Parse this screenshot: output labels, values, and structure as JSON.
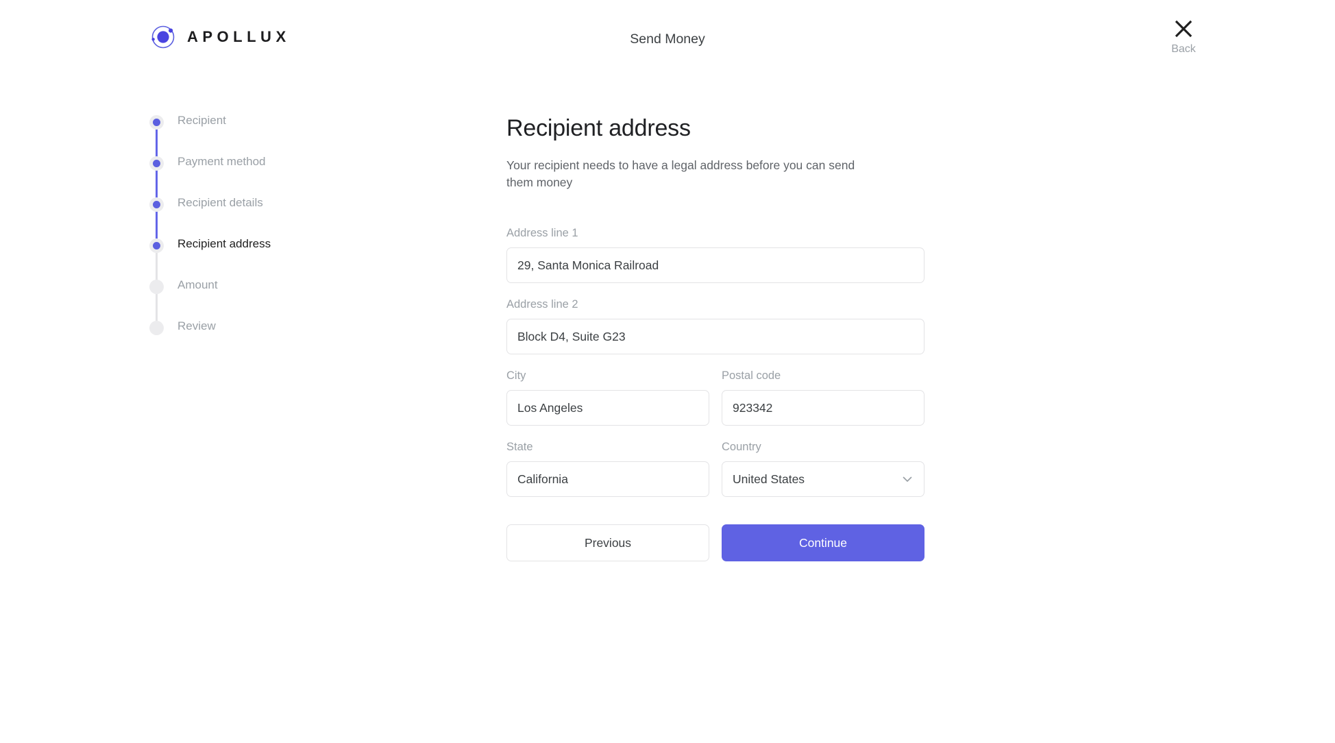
{
  "header": {
    "brand_name": "APOLLUX",
    "brand_icon": "apollux-orbit-logo",
    "title": "Send Money",
    "back_label": "Back",
    "back_icon": "close-x-icon",
    "brand_color": "#5b5fe0"
  },
  "stepper": {
    "steps": [
      {
        "label": "Recipient",
        "state": "done"
      },
      {
        "label": "Payment method",
        "state": "done"
      },
      {
        "label": "Recipient details",
        "state": "done"
      },
      {
        "label": "Recipient address",
        "state": "active"
      },
      {
        "label": "Amount",
        "state": "todo"
      },
      {
        "label": "Review",
        "state": "todo"
      }
    ],
    "done_color": "#5b5fe0",
    "todo_color": "#e4e4e6"
  },
  "form": {
    "title": "Recipient address",
    "subtitle": "Your recipient needs to have a legal address before you can send them money",
    "fields": {
      "address1": {
        "label": "Address line 1",
        "value": "29, Santa Monica Railroad",
        "placeholder": "Address line 1"
      },
      "address2": {
        "label": "Address line 2",
        "value": "Block D4, Suite G23",
        "placeholder": "Address line 2"
      },
      "city": {
        "label": "City",
        "value": "Los Angeles",
        "placeholder": "City"
      },
      "postal": {
        "label": "Postal code",
        "value": "923342",
        "placeholder": "Postal code"
      },
      "state": {
        "label": "State",
        "value": "California",
        "placeholder": "State"
      },
      "country": {
        "label": "Country",
        "value": "United States",
        "placeholder": "Country",
        "icon": "chevron-down-icon"
      }
    },
    "buttons": {
      "previous": "Previous",
      "continue": "Continue",
      "continue_color": "#5f62e3"
    }
  }
}
